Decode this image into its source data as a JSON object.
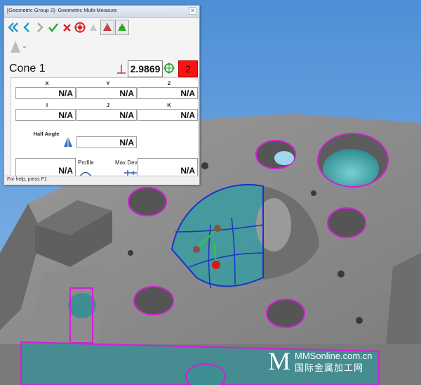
{
  "window": {
    "title": "[Geometric Group 2]- Geometric Multi-Measure",
    "close_glyph": "×"
  },
  "toolbar": {
    "icons": [
      "double-left-arrow-icon",
      "left-arrow-icon",
      "right-arrow-icon",
      "check-icon",
      "x-icon",
      "target-icon",
      "measure-grey-icon",
      "pyramid-red-icon",
      "pyramid-green-icon"
    ]
  },
  "feature": {
    "name": "Cone 1",
    "value": "2.9869",
    "status_count": "2"
  },
  "grid": {
    "row1": {
      "headers": [
        "X",
        "Y",
        "Z"
      ],
      "values": [
        "N/A",
        "N/A",
        "N/A"
      ]
    },
    "row2": {
      "headers": [
        "I",
        "J",
        "K"
      ],
      "values": [
        "N/A",
        "N/A",
        "N/A"
      ]
    },
    "half_angle": {
      "label": "Half Angle",
      "value": "N/A"
    },
    "row4": {
      "profile_label": "Profile",
      "maxdev_label": "Max Dev",
      "left_value": "N/A",
      "right_value": "N/A"
    }
  },
  "status_bar": {
    "text": "For help, press F1"
  },
  "watermark": {
    "letter": "M",
    "site": "MMSonline.com.cn",
    "cn": "国际金属加工网"
  },
  "colors": {
    "sky": "#6aa6dc",
    "part": "#828282",
    "cyan_surface": "#4aa3a6",
    "highlight": "#d21fd6",
    "blue_edge": "#1a33c8",
    "red_status": "#ff1111"
  }
}
